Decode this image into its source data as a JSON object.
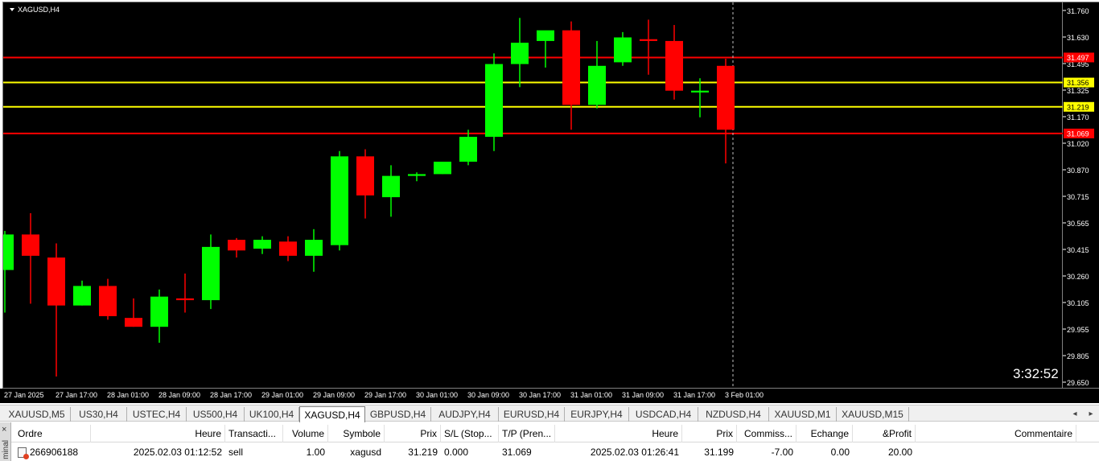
{
  "chart": {
    "title": "XAGUSD,H4",
    "countdown": "3:32:52",
    "colors": {
      "background": "#000000",
      "bull": "#00ff00",
      "bear": "#ff0000",
      "grid_text": "#ffffff",
      "line_red": "#ff0000",
      "line_yellow": "#ffff00"
    }
  },
  "chart_data": {
    "type": "candlestick",
    "symbol": "XAGUSD",
    "timeframe": "H4",
    "ylim": [
      29.65,
      31.78
    ],
    "y_ticks": [
      "31.760",
      "31.630",
      "31.495",
      "31.325",
      "31.170",
      "31.020",
      "30.870",
      "30.715",
      "30.565",
      "30.415",
      "30.260",
      "30.105",
      "29.955",
      "29.805",
      "29.650"
    ],
    "x_ticks": [
      "27 Jan 2025",
      "27 Jan 17:00",
      "28 Jan 01:00",
      "28 Jan 09:00",
      "28 Jan 17:00",
      "29 Jan 01:00",
      "29 Jan 09:00",
      "29 Jan 17:00",
      "30 Jan 01:00",
      "30 Jan 09:00",
      "30 Jan 17:00",
      "31 Jan 01:00",
      "31 Jan 09:00",
      "31 Jan 17:00",
      "3 Feb 01:00"
    ],
    "candles": [
      {
        "o": 30.3,
        "h": 30.52,
        "l": 30.06,
        "c": 30.5
      },
      {
        "o": 30.5,
        "h": 30.62,
        "l": 30.11,
        "c": 30.38
      },
      {
        "o": 30.37,
        "h": 30.45,
        "l": 29.7,
        "c": 30.1
      },
      {
        "o": 30.1,
        "h": 30.24,
        "l": 30.1,
        "c": 30.21
      },
      {
        "o": 30.21,
        "h": 30.25,
        "l": 30.02,
        "c": 30.04
      },
      {
        "o": 30.03,
        "h": 30.14,
        "l": 29.98,
        "c": 29.98
      },
      {
        "o": 29.98,
        "h": 30.19,
        "l": 29.89,
        "c": 30.15
      },
      {
        "o": 30.14,
        "h": 30.28,
        "l": 30.06,
        "c": 30.13
      },
      {
        "o": 30.13,
        "h": 30.5,
        "l": 30.08,
        "c": 30.43
      },
      {
        "o": 30.47,
        "h": 30.48,
        "l": 30.37,
        "c": 30.41
      },
      {
        "o": 30.42,
        "h": 30.49,
        "l": 30.39,
        "c": 30.47
      },
      {
        "o": 30.46,
        "h": 30.49,
        "l": 30.35,
        "c": 30.38
      },
      {
        "o": 30.38,
        "h": 30.53,
        "l": 30.29,
        "c": 30.47
      },
      {
        "o": 30.44,
        "h": 30.97,
        "l": 30.41,
        "c": 30.94
      },
      {
        "o": 30.94,
        "h": 30.98,
        "l": 30.59,
        "c": 30.72
      },
      {
        "o": 30.71,
        "h": 30.89,
        "l": 30.6,
        "c": 30.83
      },
      {
        "o": 30.83,
        "h": 30.85,
        "l": 30.8,
        "c": 30.84
      },
      {
        "o": 30.84,
        "h": 30.91,
        "l": 30.84,
        "c": 30.91
      },
      {
        "o": 30.91,
        "h": 31.09,
        "l": 30.89,
        "c": 31.05
      },
      {
        "o": 31.05,
        "h": 31.52,
        "l": 30.97,
        "c": 31.46
      },
      {
        "o": 31.46,
        "h": 31.72,
        "l": 31.33,
        "c": 31.58
      },
      {
        "o": 31.59,
        "h": 31.64,
        "l": 31.44,
        "c": 31.65
      },
      {
        "o": 31.65,
        "h": 31.7,
        "l": 31.09,
        "c": 31.23
      },
      {
        "o": 31.23,
        "h": 31.59,
        "l": 31.21,
        "c": 31.45
      },
      {
        "o": 31.47,
        "h": 31.64,
        "l": 31.45,
        "c": 31.61
      },
      {
        "o": 31.6,
        "h": 31.71,
        "l": 31.4,
        "c": 31.59
      },
      {
        "o": 31.59,
        "h": 31.68,
        "l": 31.26,
        "c": 31.31
      },
      {
        "o": 31.3,
        "h": 31.38,
        "l": 31.16,
        "c": 31.31
      },
      {
        "o": 31.45,
        "h": 31.49,
        "l": 30.9,
        "c": 31.09
      }
    ],
    "levels": [
      {
        "price": 31.497,
        "label": "31.497",
        "color": "#ff0000"
      },
      {
        "price": 31.356,
        "label": "31.356",
        "color": "#ffff00"
      },
      {
        "price": 31.219,
        "label": "31.219",
        "color": "#ffff00"
      },
      {
        "price": 31.069,
        "label": "31.069",
        "color": "#ff0000"
      }
    ]
  },
  "tabs": [
    "XAUUSD,M5",
    "US30,H4",
    "USTEC,H4",
    "US500,H4",
    "UK100,H4",
    "XAGUSD,H4",
    "GBPUSD,H4",
    "AUDJPY,H4",
    "EURUSD,H4",
    "EURJPY,H4",
    "USDCAD,H4",
    "NZDUSD,H4",
    "XAUUSD,M1",
    "XAUUSD,M15"
  ],
  "active_tab": "XAGUSD,H4",
  "terminal": {
    "side_label": "minal",
    "close_icon": "close-icon",
    "headers": [
      "Ordre",
      "Heure",
      "Transacti...",
      "Volume",
      "Symbole",
      "Prix",
      "S/L (Stop...",
      "T/P (Pren...",
      "Heure",
      "Prix",
      "Commiss...",
      "Echange",
      "&Profit",
      "Commentaire"
    ],
    "row": [
      "266906188",
      "2025.02.03 01:12:52",
      "sell",
      "1.00",
      "xagusd",
      "31.219",
      "0.000",
      "31.069",
      "2025.02.03 01:26:41",
      "31.199",
      "-7.00",
      "0.00",
      "20.00",
      ""
    ]
  }
}
